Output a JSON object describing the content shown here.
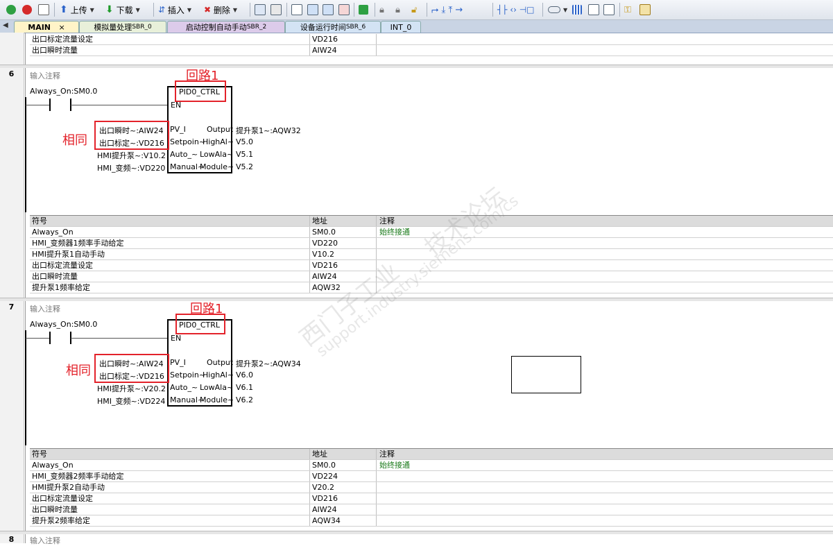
{
  "toolbar": {
    "upload_label": "上传",
    "download_label": "下载",
    "insert_label": "插入",
    "delete_label": "删除"
  },
  "tabs": [
    {
      "label": "MAIN",
      "close": "×"
    },
    {
      "label": "模拟量处理",
      "suffix": "SBR_0"
    },
    {
      "label": "启动控制自动手动",
      "suffix": "SBR_2"
    },
    {
      "label": "设备运行时间",
      "suffix": "SBR_6"
    },
    {
      "label": "INT_0"
    }
  ],
  "top_rows": [
    {
      "symbol": "出口标定流量设定",
      "address": "VD216"
    },
    {
      "symbol": "出口瞬时流量",
      "address": "AIW24"
    }
  ],
  "networks": [
    {
      "number": "6",
      "comment": "输入注释",
      "annotation_loop": "回路1",
      "annotation_same": "相同",
      "contact": "Always_On:SM0.0",
      "block_name": "PID0_CTRL",
      "en": "EN",
      "inputs": [
        {
          "var": "出口瞬时~:AIW24",
          "pin": "PV_I"
        },
        {
          "var": "出口标定~:VD216",
          "pin": "Setpoin~"
        },
        {
          "var": "HMI提升泵~:V10.2",
          "pin": "Auto_~"
        },
        {
          "var": "HMI_变频~:VD220",
          "pin": "Manual~"
        }
      ],
      "outputs": [
        {
          "pin": "Output",
          "var": "提升泵1~:AQW32"
        },
        {
          "pin": "HighAl~",
          "var": "V5.0"
        },
        {
          "pin": "LowAla~",
          "var": "V5.1"
        },
        {
          "pin": "Module~",
          "var": "V5.2"
        }
      ],
      "table_header": {
        "symbol": "符号",
        "address": "地址",
        "comment": "注释"
      },
      "table": [
        {
          "symbol": "Always_On",
          "address": "SM0.0",
          "comment": "始终接通"
        },
        {
          "symbol": "HMI_变频器1频率手动给定",
          "address": "VD220",
          "comment": ""
        },
        {
          "symbol": "HMI提升泵1自动手动",
          "address": "V10.2",
          "comment": ""
        },
        {
          "symbol": "出口标定流量设定",
          "address": "VD216",
          "comment": ""
        },
        {
          "symbol": "出口瞬时流量",
          "address": "AIW24",
          "comment": ""
        },
        {
          "symbol": "提升泵1频率给定",
          "address": "AQW32",
          "comment": ""
        }
      ]
    },
    {
      "number": "7",
      "comment": "输入注释",
      "annotation_loop": "回路1",
      "annotation_same": "相同",
      "contact": "Always_On:SM0.0",
      "block_name": "PID0_CTRL",
      "en": "EN",
      "inputs": [
        {
          "var": "出口瞬时~:AIW24",
          "pin": "PV_I"
        },
        {
          "var": "出口标定~:VD216",
          "pin": "Setpoin~"
        },
        {
          "var": "HMI提升泵~:V20.2",
          "pin": "Auto_~"
        },
        {
          "var": "HMI_变频~:VD224",
          "pin": "Manual~"
        }
      ],
      "outputs": [
        {
          "pin": "Output",
          "var": "提升泵2~:AQW34"
        },
        {
          "pin": "HighAl~",
          "var": "V6.0"
        },
        {
          "pin": "LowAla~",
          "var": "V6.1"
        },
        {
          "pin": "Module~",
          "var": "V6.2"
        }
      ],
      "table_header": {
        "symbol": "符号",
        "address": "地址",
        "comment": "注释"
      },
      "table": [
        {
          "symbol": "Always_On",
          "address": "SM0.0",
          "comment": "始终接通"
        },
        {
          "symbol": "HMI_变频器2频率手动给定",
          "address": "VD224",
          "comment": ""
        },
        {
          "symbol": "HMI提升泵2自动手动",
          "address": "V20.2",
          "comment": ""
        },
        {
          "symbol": "出口标定流量设定",
          "address": "VD216",
          "comment": ""
        },
        {
          "symbol": "出口瞬时流量",
          "address": "AIW24",
          "comment": ""
        },
        {
          "symbol": "提升泵2频率给定",
          "address": "AQW34",
          "comment": ""
        }
      ]
    },
    {
      "number": "8",
      "comment": "输入注释"
    }
  ],
  "watermark": {
    "line1": "西门子工业",
    "line2": "技术论坛",
    "line3": "support.industry.siemens.com/cs"
  }
}
